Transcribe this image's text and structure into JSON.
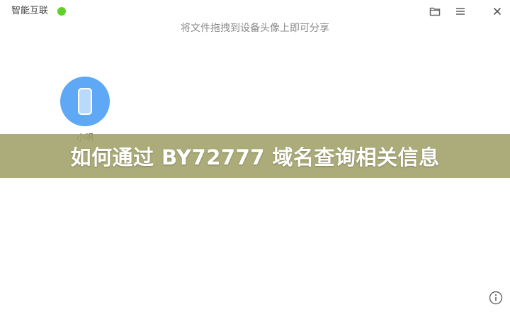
{
  "app": {
    "title": "智能互联",
    "status_color": "#5fcf2a"
  },
  "toolbar": {
    "folder_icon": "folder-icon",
    "menu_icon": "menu-icon",
    "close_icon": "close-icon"
  },
  "hint_text": "将文件拖拽到设备头像上即可分享",
  "devices": [
    {
      "name": "小明",
      "icon": "phone-icon",
      "color": "#5ea8f5"
    }
  ],
  "banner": {
    "text": "如何通过 BY72777 域名查询相关信息"
  },
  "footer": {
    "info_icon": "info-icon"
  }
}
